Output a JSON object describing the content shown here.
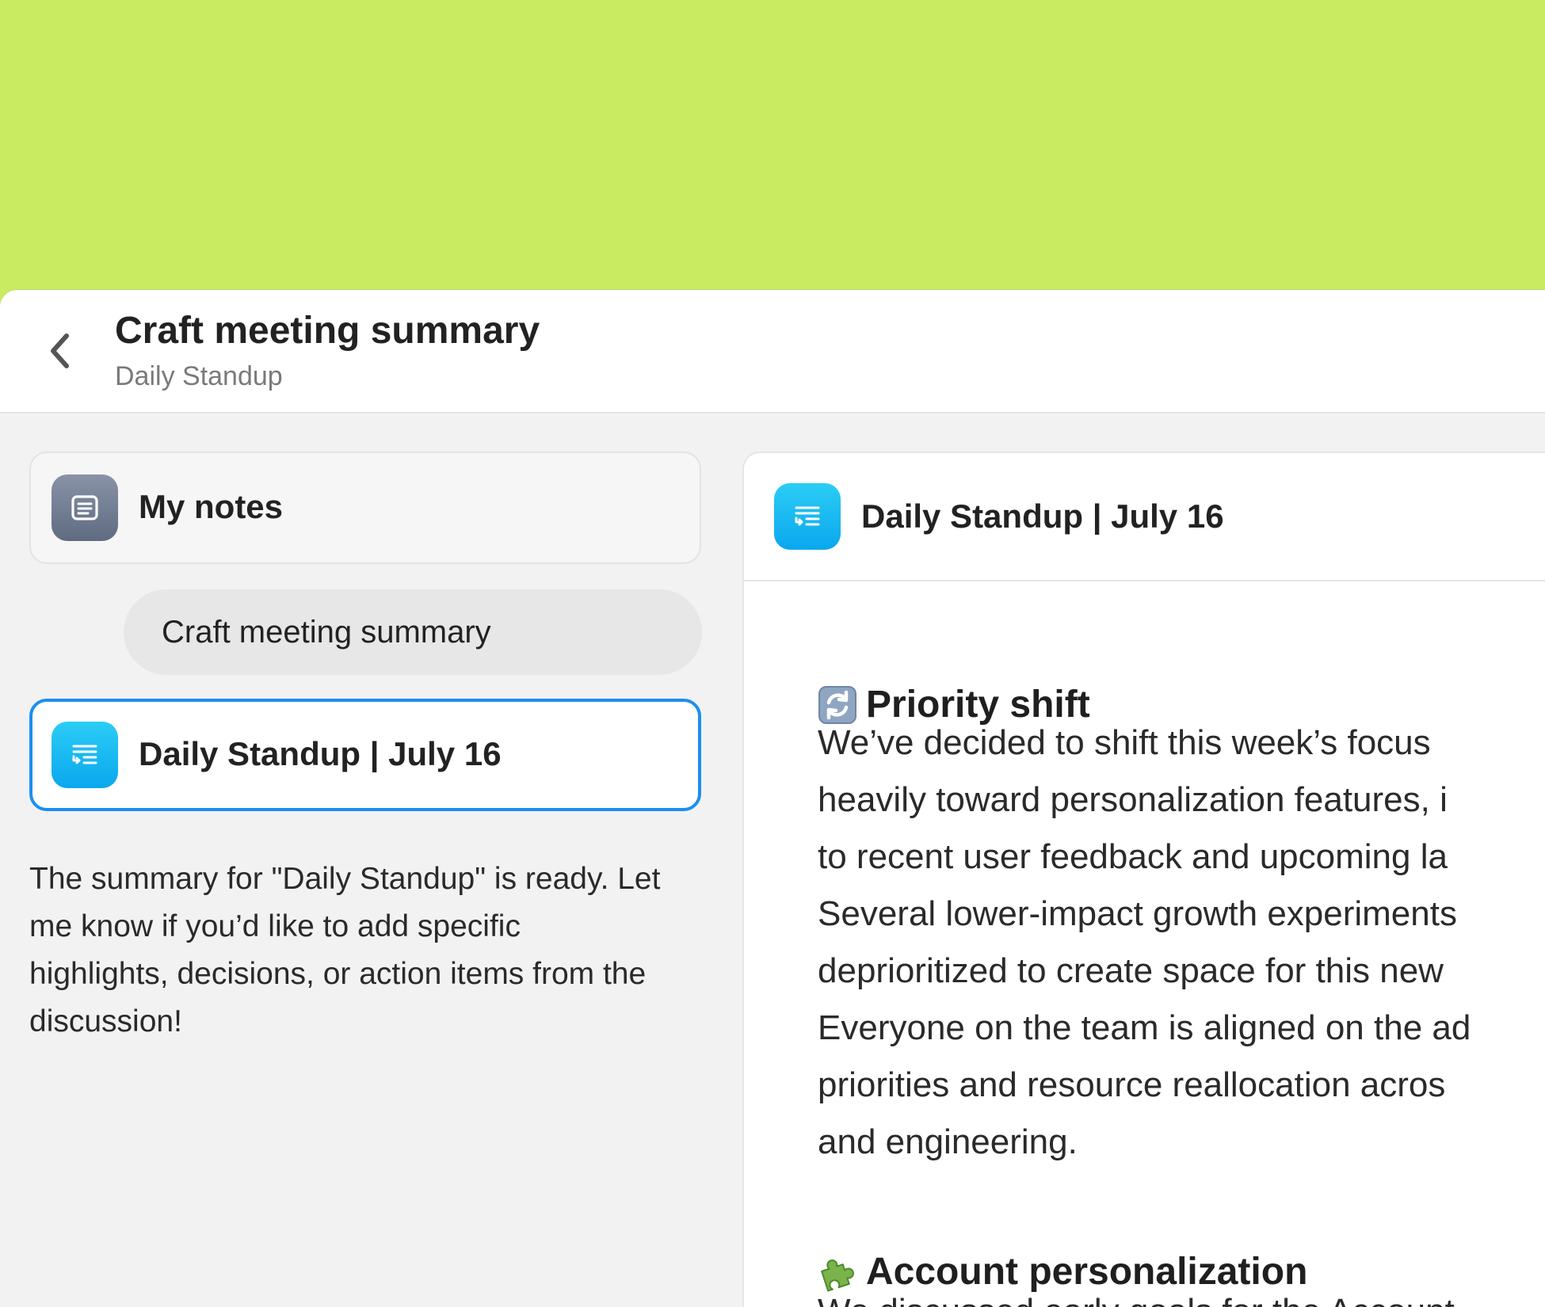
{
  "colors": {
    "backdrop": "#c8eb62",
    "accent_blue": "#1b8ff0",
    "icon_blue": "#0aa7ee",
    "icon_gray": "#6b7689"
  },
  "header": {
    "title": "Craft meeting summary",
    "subtitle": "Daily Standup",
    "back_icon": "chevron-left-icon"
  },
  "sidebar": {
    "my_notes": {
      "label": "My notes",
      "icon": "note-icon"
    },
    "user_message": "Craft meeting summary",
    "selected_doc": {
      "label": "Daily Standup | July 16",
      "icon": "summary-doc-icon"
    },
    "assistant_message": "The summary for \"Daily Standup\" is ready. Let me know if you’d like to add specific highlights, decisions, or action items from the discussion!"
  },
  "document": {
    "title": "Daily Standup | July 16",
    "icon": "summary-doc-icon",
    "sections": [
      {
        "emoji": "refresh-arrows-icon",
        "heading": "Priority shift",
        "lines": [
          "We’ve decided to shift this week’s focus",
          "heavily toward personalization features, i",
          "to recent user feedback and upcoming la",
          "Several lower-impact growth experiments",
          "deprioritized to create space for this new",
          "Everyone on the team is aligned on the ad",
          "priorities and resource reallocation acros",
          "and engineering."
        ]
      },
      {
        "emoji": "puzzle-piece-icon",
        "heading": "Account personalization",
        "lines": [
          "We discussed early goals for the Account"
        ]
      }
    ]
  }
}
